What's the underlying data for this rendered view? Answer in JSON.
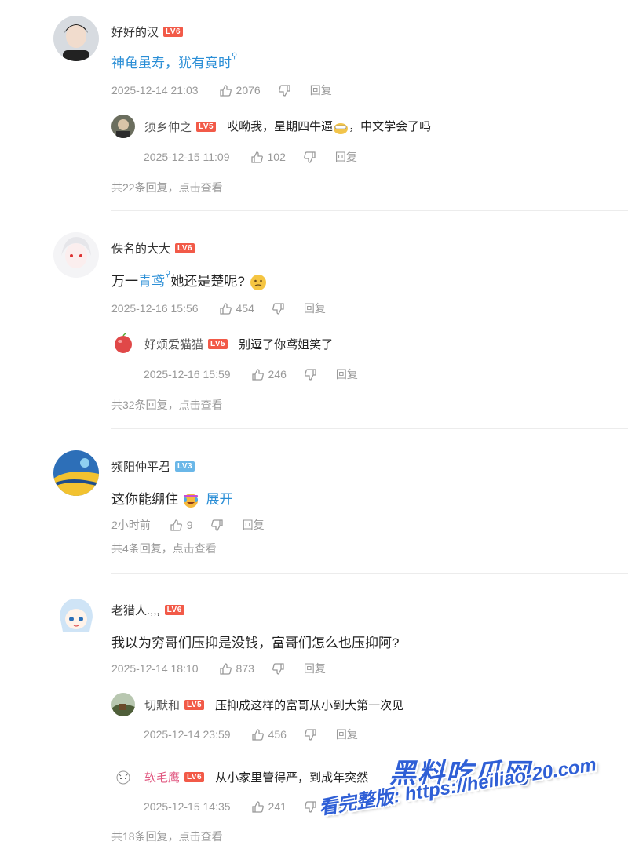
{
  "comments": [
    {
      "user": "好好的汉",
      "level": "LV6",
      "text": "神龟虽寿，犹有竟时",
      "time": "2025-12-14 21:03",
      "likes": "2076",
      "reply_label": "回复",
      "reply": {
        "user": "须乡伸之",
        "level": "LV5",
        "text_a": "哎呦我，星期四牛逼",
        "text_b": "，中文学会了吗",
        "time": "2025-12-15 11:09",
        "likes": "102",
        "reply_label": "回复"
      },
      "more": "共22条回复，点击查看"
    },
    {
      "user": "佚名的大大",
      "level": "LV6",
      "text_a": "万一",
      "text_link": "青鸢",
      "text_b": "她还是楚呢?",
      "time": "2025-12-16 15:56",
      "likes": "454",
      "reply_label": "回复",
      "reply": {
        "user": "好烦爱猫猫",
        "level": "LV5",
        "text": "别逗了你鸢姐笑了",
        "time": "2025-12-16 15:59",
        "likes": "246",
        "reply_label": "回复"
      },
      "more": "共32条回复，点击查看"
    },
    {
      "user": "频阳仲平君",
      "level": "LV3",
      "text": "这你能绷住",
      "expand": "展开",
      "time": "2小时前",
      "likes": "9",
      "reply_label": "回复",
      "more": "共4条回复，点击查看"
    },
    {
      "user": "老猎人.,,,",
      "level": "LV6",
      "text": "我以为穷哥们压抑是没钱，富哥们怎么也压抑阿?",
      "time": "2025-12-14 18:10",
      "likes": "873",
      "reply_label": "回复",
      "reply": {
        "user": "切默和",
        "level": "LV5",
        "text": "压抑成这样的富哥从小到大第一次见",
        "time": "2025-12-14 23:59",
        "likes": "456",
        "reply_label": "回复"
      },
      "reply2": {
        "user": "软毛鹰",
        "level": "LV6",
        "text": "从小家里管得严，到成年突然",
        "time": "2025-12-15 14:35",
        "likes": "241",
        "reply_label": "回复"
      },
      "more": "共18条回复，点击查看"
    }
  ],
  "watermark": {
    "brand": "黑料吃瓜网",
    "url": "看完整版: https://heiliao-20.com"
  },
  "colors": {
    "link": "#2a8ed6",
    "level_red": "#f25a48",
    "level_blue": "#6ab7e8",
    "meta": "#999999"
  },
  "icons": {
    "like": "thumbs-up-icon",
    "dislike": "thumbs-down-icon",
    "search_pin": "search-mini-icon"
  }
}
